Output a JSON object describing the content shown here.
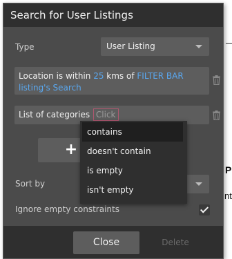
{
  "dialog": {
    "title": "Search for User Listings",
    "type_label": "Type",
    "type_value": "User Listing",
    "constraint_1": {
      "text_a": "Location is within ",
      "distance": "25",
      "text_b": " kms",
      "text_c": " of ",
      "source": "FILTER BAR listing's Search"
    },
    "constraint_2": {
      "label": "List of categories",
      "operator_placeholder": "Click"
    },
    "add_label": "+",
    "sort_label": "Sort by",
    "ignore_label": "Ignore empty constraints",
    "ignore_checked": true,
    "close_label": "Close",
    "delete_label": "Delete"
  },
  "operator_dropdown": {
    "items": [
      "contains",
      "doesn't contain",
      "is empty",
      "isn't empty"
    ],
    "highlighted_index": 0
  },
  "background": {
    "fragment_1": "P",
    "fragment_2": "nt"
  },
  "colors": {
    "dialog_bg": "#4b4b4b",
    "header_bg": "#2f2f2f",
    "field_bg": "#5d5d5d",
    "dynamic_link": "#5aa8f0",
    "click_border": "#b05870"
  }
}
